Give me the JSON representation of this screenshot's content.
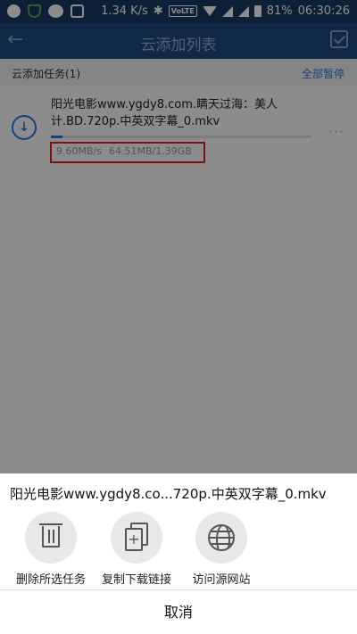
{
  "status_bar": {
    "network_speed": "1.34 K/s",
    "volte": "VoLTE",
    "battery": "81%",
    "time": "06:30:26"
  },
  "app_bar": {
    "title": "云添加列表",
    "back_icon": "back-arrow-icon",
    "check_icon": "checklist-icon"
  },
  "section": {
    "title": "云添加任务(1)",
    "pause_all": "全部暂停"
  },
  "task": {
    "name": "阳光电影www.ygdy8.com.瞒天过海：美人计.BD.720p.中英双字幕_0.mkv",
    "speed": "9.60MB/s",
    "size": "64.51MB/1.39GB",
    "progress": 0.045,
    "more": "···"
  },
  "sheet": {
    "title": "阳光电影www.ygdy8.co...720p.中英双字幕_0.mkv",
    "actions": [
      {
        "label": "删除所选任务",
        "icon": "trash-icon"
      },
      {
        "label": "复制下载链接",
        "icon": "copy-icon"
      },
      {
        "label": "访问源网站",
        "icon": "globe-icon"
      }
    ],
    "cancel": "取消"
  },
  "colors": {
    "status_bar": "#1a3a66",
    "app_bar": "#1f4a80",
    "accent": "#2a7be0",
    "highlight_box": "#e02020"
  }
}
